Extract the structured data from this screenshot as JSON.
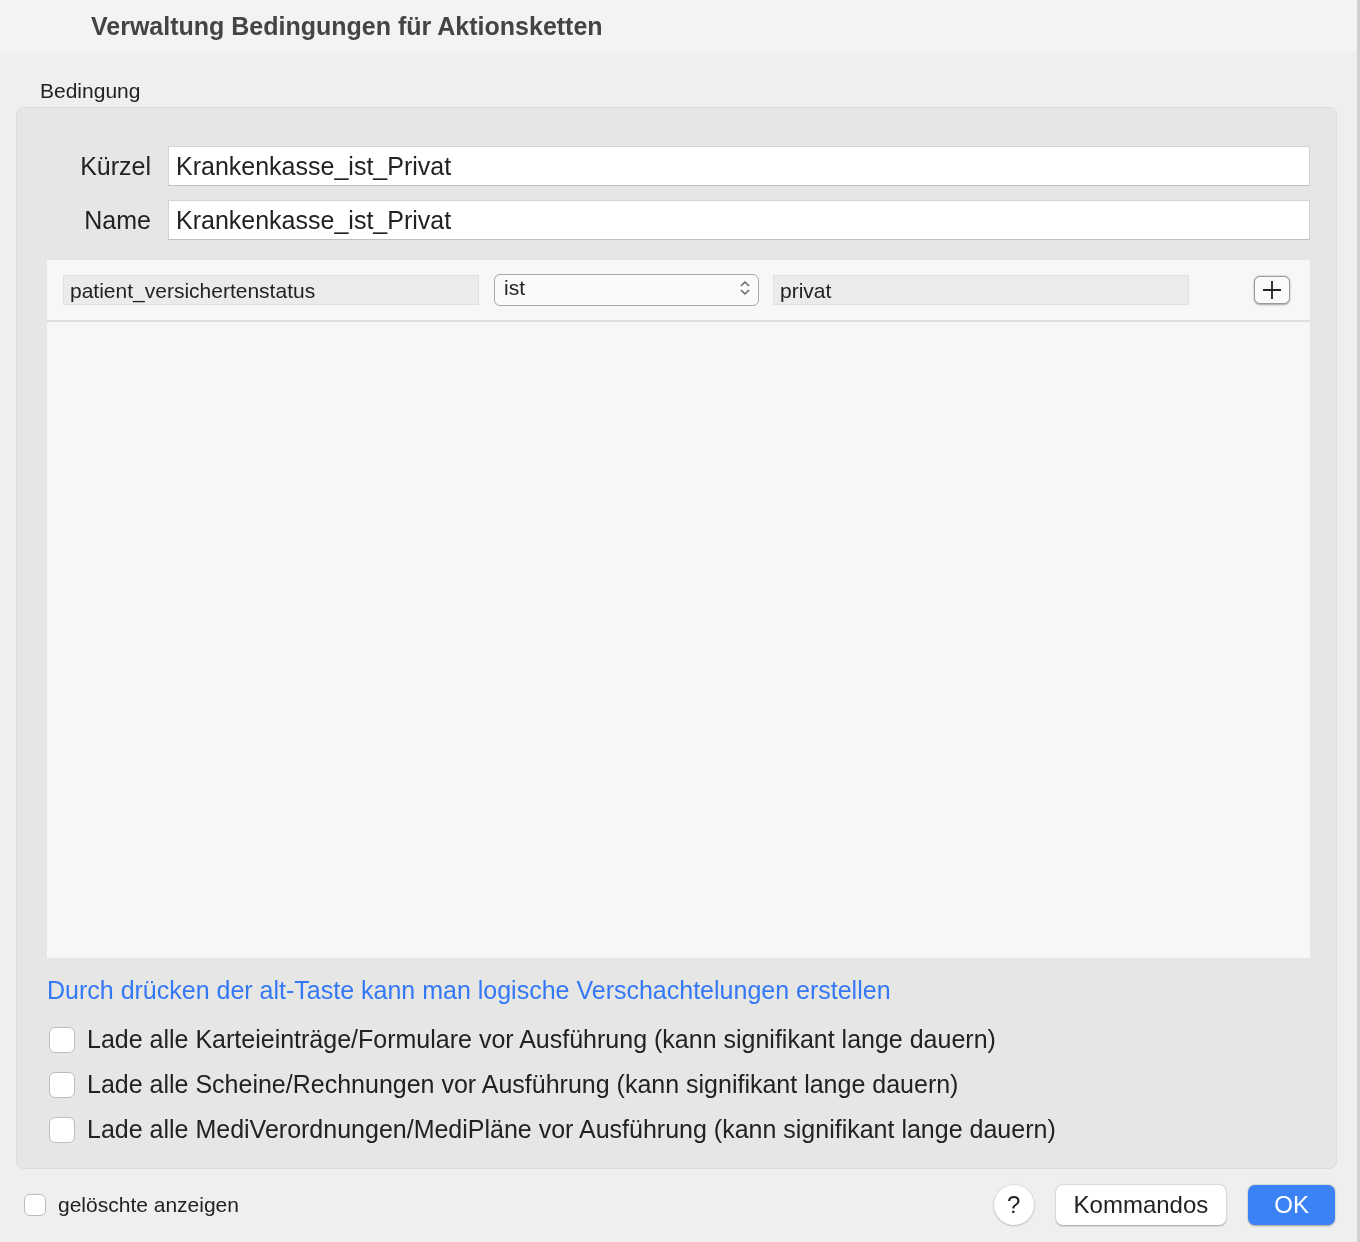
{
  "window": {
    "title": "Verwaltung Bedingungen für Aktionsketten"
  },
  "group": {
    "label": "Bedingung"
  },
  "fields": [
    {
      "label": "Kürzel",
      "value": "Krankenkasse_ist_Privat"
    },
    {
      "label": "Name",
      "value": "Krankenkasse_ist_Privat"
    }
  ],
  "rule": {
    "field": "patient_versichertenstatus",
    "operator": "ist",
    "value": "privat"
  },
  "hint": "Durch drücken der alt-Taste kann man logische Verschachtelungen erstellen",
  "options": [
    {
      "label": "Lade alle Karteieinträge/Formulare vor Ausführung (kann signifikant lange dauern)",
      "checked": false
    },
    {
      "label": "Lade alle Scheine/Rechnungen vor Ausführung (kann signifikant lange dauern)",
      "checked": false
    },
    {
      "label": "Lade alle MediVerordnungen/MediPläne vor Ausführung (kann signifikant lange dauern)",
      "checked": false
    }
  ],
  "footer": {
    "show_deleted": {
      "label": "gelöschte anzeigen",
      "checked": false
    },
    "buttons": [
      {
        "label": "?",
        "kind": "help"
      },
      {
        "label": "Kommandos",
        "kind": "normal"
      },
      {
        "label": "OK",
        "kind": "default"
      }
    ]
  }
}
